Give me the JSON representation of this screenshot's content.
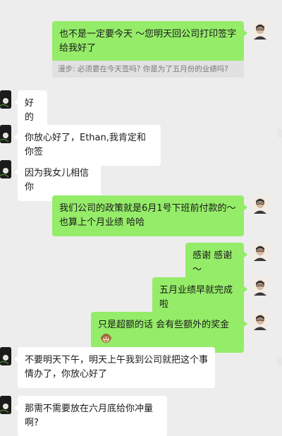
{
  "conversation": {
    "messages": [
      {
        "side": "me",
        "text": "也不是一定要今天 ～您明天回公司打印签字给我好了"
      },
      {
        "side": "quote",
        "text": "漫步: 必须要在今天签吗? 你是为了五月份的业绩吗?"
      },
      {
        "side": "other",
        "text": "好的"
      },
      {
        "side": "other",
        "text": "你放心好了，Ethan,我肯定和你签"
      },
      {
        "side": "other",
        "text": "因为我女儿相信你"
      },
      {
        "side": "me",
        "text": "我们公司的政策就是6月1号下班前付款的～也算上个月业绩 哈哈"
      },
      {
        "side": "me",
        "text": "感谢 感谢～"
      },
      {
        "side": "me",
        "text": "五月业绩早就完成啦"
      },
      {
        "side": "me",
        "text": "只是超额的话 会有些额外的奖金",
        "emoji": "monkey-face-emoji"
      },
      {
        "side": "other",
        "text": "不要明天下午，明天上午我到公司就把这个事情办了，你放心好了"
      },
      {
        "side": "other",
        "text": "那需不需要放在六月底给你冲量啊?"
      }
    ]
  },
  "colors": {
    "background": "#ededed",
    "my_bubble": "#95ec69",
    "other_bubble": "#ffffff",
    "quote_bg": "#e1e1e1",
    "quote_text": "#7a7a7a"
  },
  "icons": {
    "my_avatar": "avatar-man-with-glasses",
    "other_avatar": "avatar-dark-flower-icon",
    "emoji": "monkey-face-emoji"
  }
}
